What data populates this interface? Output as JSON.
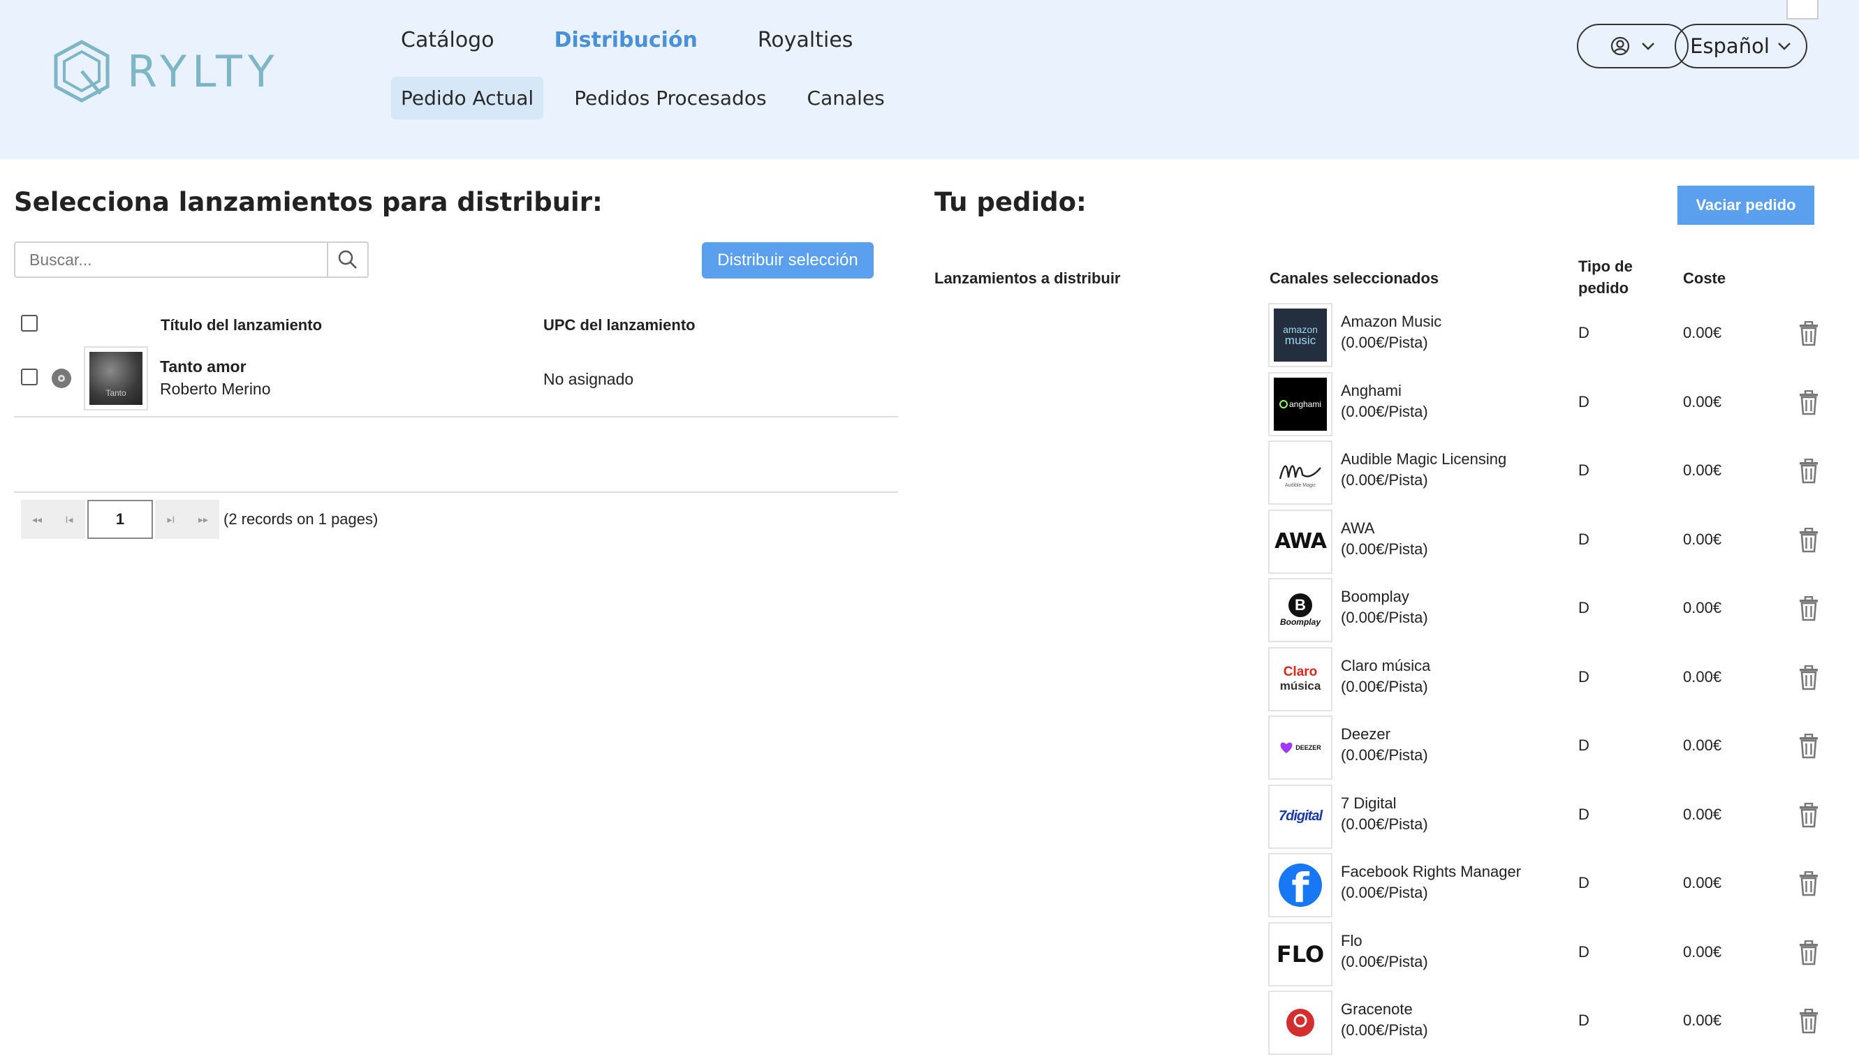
{
  "brand": {
    "name": "RYLTY"
  },
  "nav": {
    "main": [
      "Catálogo",
      "Distribución",
      "Royalties"
    ],
    "sub": [
      "Pedido Actual",
      "Pedidos Procesados",
      "Canales"
    ]
  },
  "header": {
    "language": "Español"
  },
  "left": {
    "title": "Selecciona lanzamientos para distribuir:",
    "search_placeholder": "Buscar...",
    "distribute_button": "Distribuir selección",
    "columns": {
      "title": "Título del lanzamiento",
      "upc": "UPC del lanzamiento"
    },
    "releases": [
      {
        "title": "Tanto amor",
        "artist": "Roberto Merino",
        "upc": "No asignado",
        "cover_text": "Tanto"
      }
    ],
    "pagination": {
      "page": "1",
      "info": "(2 records on 1 pages)",
      "first": "◂◂",
      "prev": "I◂",
      "next": "▸I",
      "last": "▸▸"
    }
  },
  "right": {
    "title": "Tu pedido:",
    "clear_button": "Vaciar pedido",
    "columns": {
      "releases": "Lanzamientos a distribuir",
      "channels": "Canales seleccionados",
      "type_line1": "Tipo de",
      "type_line2": "pedido",
      "cost": "Coste"
    },
    "channels": [
      {
        "name": "Amazon Music",
        "price": "(0.00€/Pista)",
        "type": "D",
        "cost": "0.00€",
        "logo": "amazon",
        "logo_text1": "amazon",
        "logo_text2": "music"
      },
      {
        "name": "Anghami",
        "price": "(0.00€/Pista)",
        "type": "D",
        "cost": "0.00€",
        "logo": "anghami",
        "logo_text1": "anghami"
      },
      {
        "name": "Audible Magic Licensing",
        "price": "(0.00€/Pista)",
        "type": "D",
        "cost": "0.00€",
        "logo": "audible",
        "logo_text1": "Audible Magic"
      },
      {
        "name": "AWA",
        "price": "(0.00€/Pista)",
        "type": "D",
        "cost": "0.00€",
        "logo": "awa",
        "logo_text1": "AWA"
      },
      {
        "name": "Boomplay",
        "price": "(0.00€/Pista)",
        "type": "D",
        "cost": "0.00€",
        "logo": "boomplay",
        "logo_text1": "B",
        "logo_text2": "Boomplay"
      },
      {
        "name": "Claro música",
        "price": "(0.00€/Pista)",
        "type": "D",
        "cost": "0.00€",
        "logo": "claro",
        "logo_text1": "Claro",
        "logo_text2": "música"
      },
      {
        "name": "Deezer",
        "price": "(0.00€/Pista)",
        "type": "D",
        "cost": "0.00€",
        "logo": "deezer",
        "logo_text1": "DEEZER"
      },
      {
        "name": "7 Digital",
        "price": "(0.00€/Pista)",
        "type": "D",
        "cost": "0.00€",
        "logo": "7digital",
        "logo_text1": "7digital"
      },
      {
        "name": "Facebook Rights Manager",
        "price": "(0.00€/Pista)",
        "type": "D",
        "cost": "0.00€",
        "logo": "facebook",
        "logo_text1": "f"
      },
      {
        "name": "Flo",
        "price": "(0.00€/Pista)",
        "type": "D",
        "cost": "0.00€",
        "logo": "flo",
        "logo_text1": "FLO"
      },
      {
        "name": "Gracenote",
        "price": "(0.00€/Pista)",
        "type": "D",
        "cost": "0.00€",
        "logo": "gracenote"
      }
    ]
  },
  "colors": {
    "accent": "#5aa0ef",
    "header_bg": "#eaf3fd",
    "nav_active": "#4a90d9"
  }
}
